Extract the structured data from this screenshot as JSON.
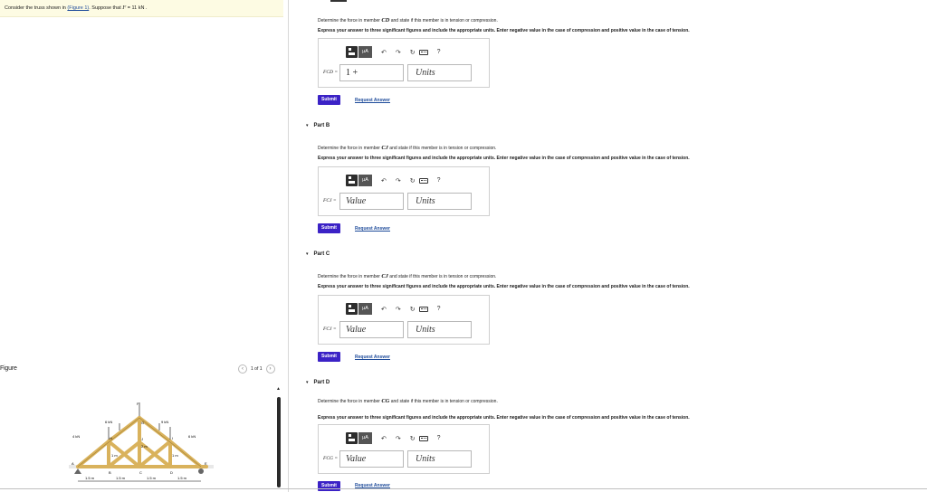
{
  "intro": {
    "prefix": "Consider the truss shown in ",
    "link": "(Figure 1)",
    "middle": ". Suppose that ",
    "var": "F",
    "suffix": " = 11  kN ."
  },
  "figure": {
    "label": "Figure",
    "pager": "1 of 1",
    "prev_icon": "chevron-left",
    "next_icon": "chevron-right",
    "truss": {
      "loads": [
        "6 kN",
        "9 kN",
        "4 kN",
        "6 kN",
        "F"
      ],
      "joints": [
        "A",
        "B",
        "C",
        "D",
        "E",
        "G",
        "H",
        "I",
        "J"
      ],
      "dims": [
        "2 m",
        "1 m",
        "1 m"
      ],
      "spans": [
        "1.5 m",
        "1.5 m",
        "1.5 m",
        "1.5 m"
      ]
    }
  },
  "toolbar": {
    "ua_label": "µA",
    "undo": "↶",
    "redo": "↷",
    "reset": "↻",
    "help": "?"
  },
  "parts": [
    {
      "title": "",
      "question_pre": "Determine the force in member ",
      "member": "CD",
      "question_post": " and state if this member is in tension or compression.",
      "instruction": "Express your answer to three significant figures and include the appropriate units. Enter negative value in the case of compression and positive value in the case of tension.",
      "var_label": "FCD =",
      "value": "1 +",
      "value_placeholder": "Value",
      "units_placeholder": "Units",
      "submit": "Submit",
      "request": "Request Answer"
    },
    {
      "title": "Part B",
      "question_pre": "Determine the force in member ",
      "member": "CJ",
      "question_post": " and state if this member is in tension or compression.",
      "instruction": "Express your answer to three significant figures and include the appropriate units. Enter negative value in the case of compression and positive value in the case of tension.",
      "var_label": "FCJ =",
      "value": "",
      "value_placeholder": "Value",
      "units_placeholder": "Units",
      "submit": "Submit",
      "request": "Request Answer"
    },
    {
      "title": "Part C",
      "question_pre": "Determine the force in member ",
      "member": "CJ",
      "question_post": " and state if this member is in tension or compression.",
      "instruction": "Express your answer to three significant figures and include the appropriate units. Enter negative value in the case of compression and positive value in the case of tension.",
      "var_label": "FCJ =",
      "value": "",
      "value_placeholder": "Value",
      "units_placeholder": "Units",
      "submit": "Submit",
      "request": "Request Answer"
    },
    {
      "title": "Part D",
      "question_pre": "Determine the force in member ",
      "member": "CG",
      "question_post": " and state if this member is in tension or compression.",
      "instruction": "Express your answer to three significant figures and include the appropriate units. Enter negative value in the case of compression and positive value in the case of tension.",
      "var_label": "FCG =",
      "value": "",
      "value_placeholder": "Value",
      "units_placeholder": "Units",
      "submit": "Submit",
      "request": "Request Answer"
    }
  ],
  "colors": {
    "submit": "#3b22c6",
    "link": "#1e4b9a",
    "intro_bg": "#fdfbe3",
    "truss_wood": "#d9b25c"
  }
}
